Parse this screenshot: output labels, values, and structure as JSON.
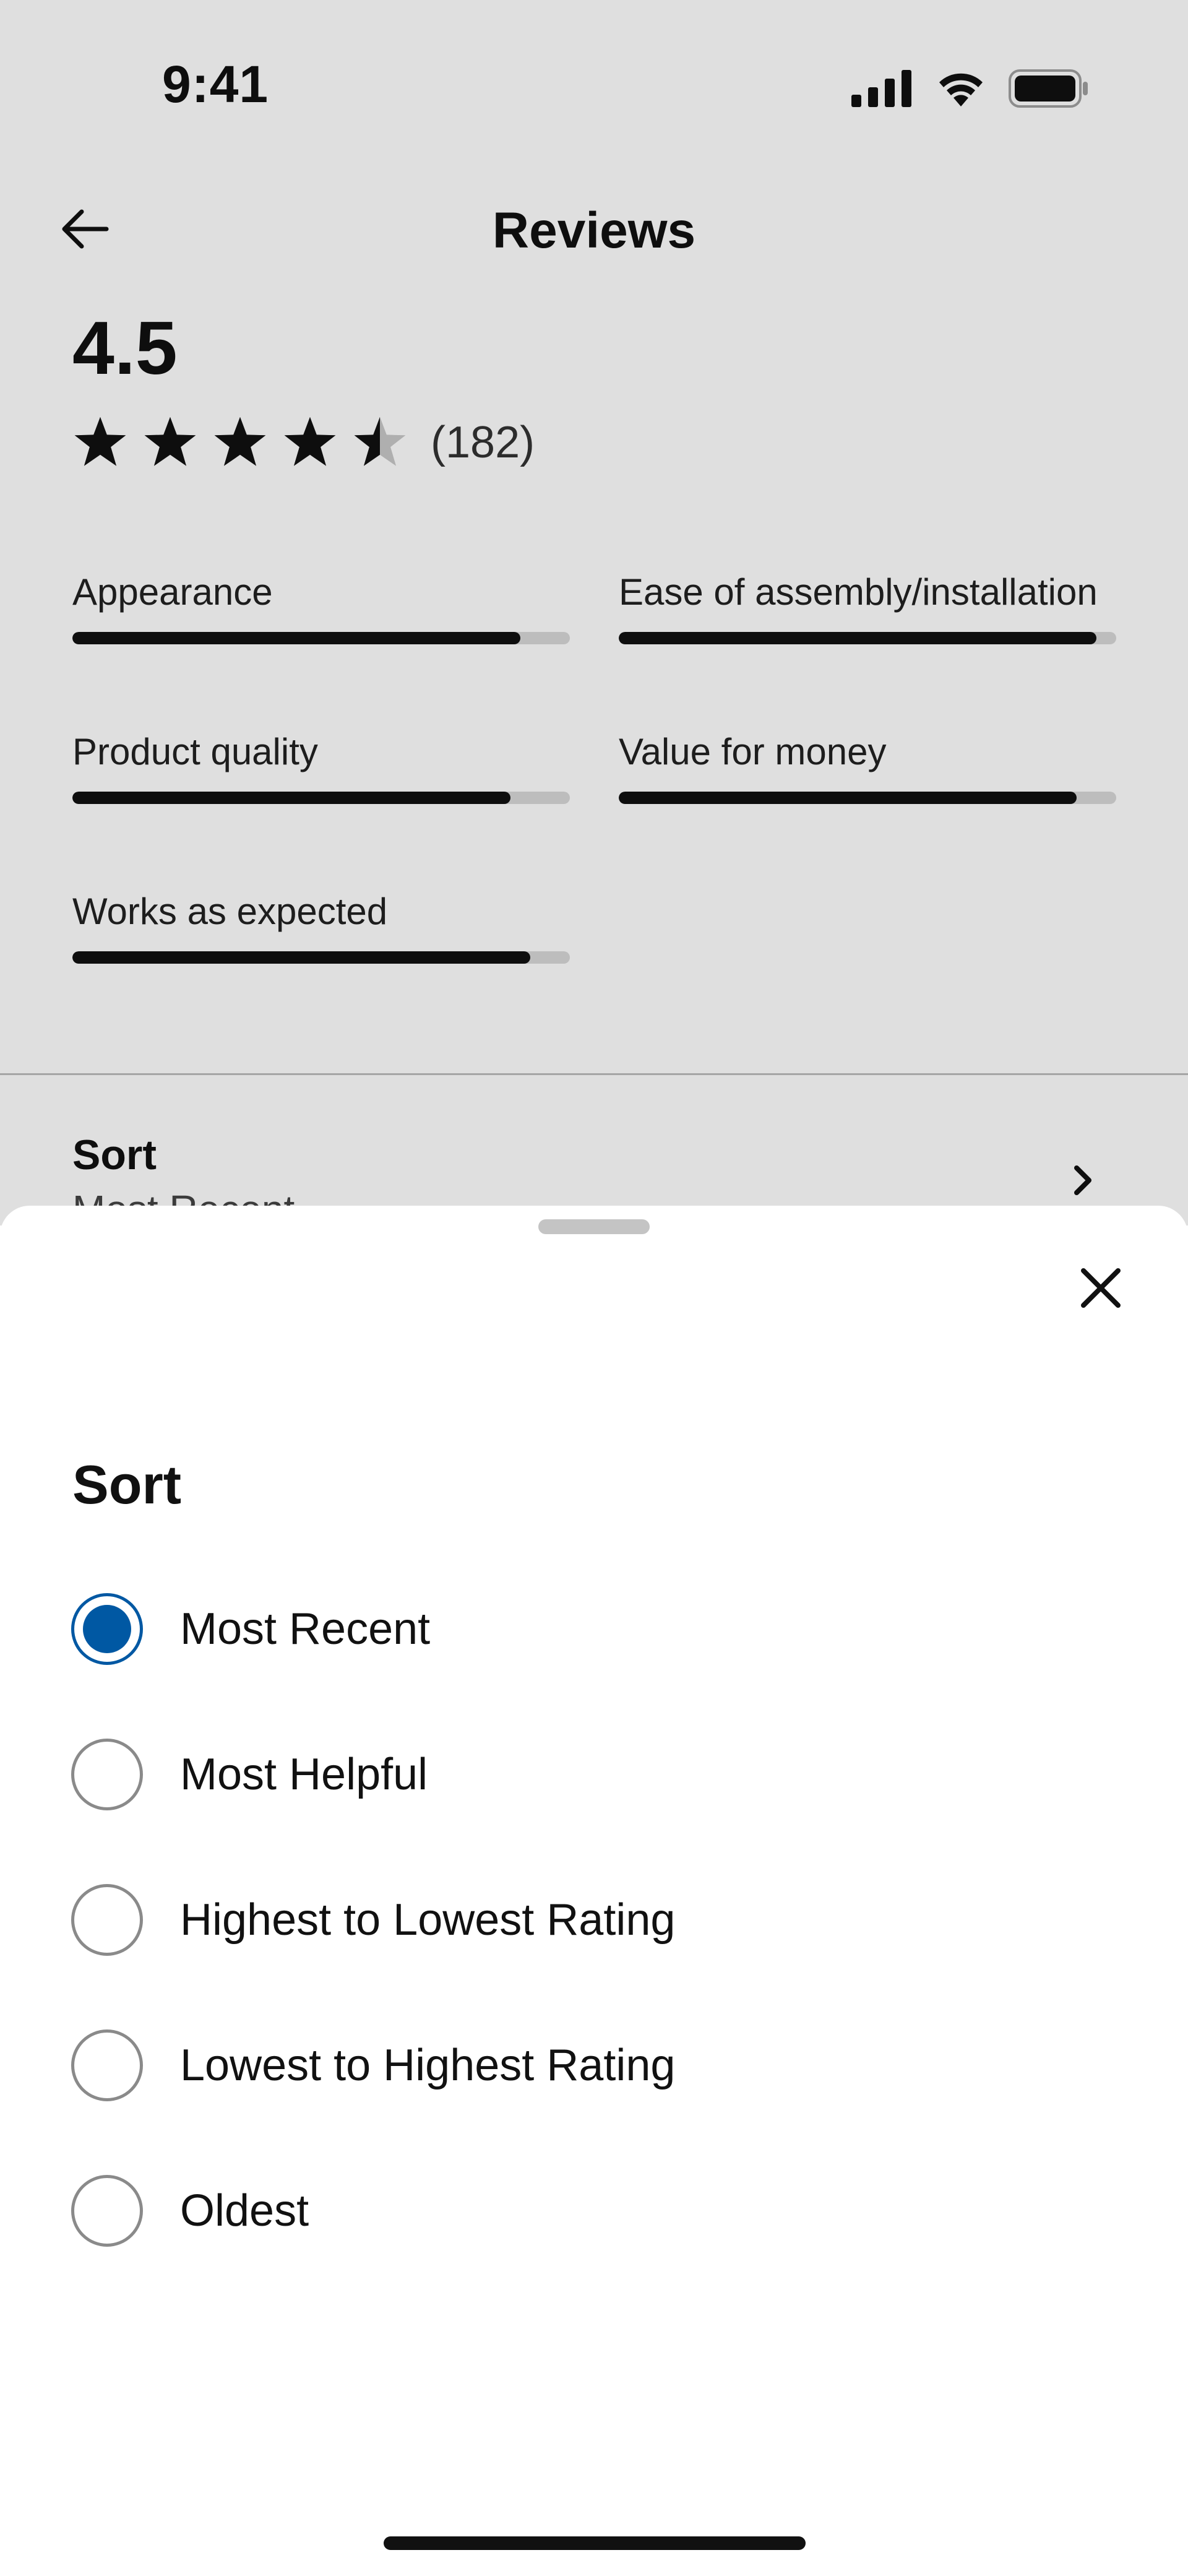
{
  "status_bar": {
    "time": "9:41",
    "icons": [
      "cellular-signal-icon",
      "wifi-icon",
      "battery-icon"
    ]
  },
  "nav": {
    "title": "Reviews",
    "back_icon": "arrow-left-icon"
  },
  "summary": {
    "rating": "4.5",
    "stars_value": 4.5,
    "stars_max": 5,
    "review_count": "(182)"
  },
  "attributes": [
    {
      "label": "Appearance",
      "fill": 0.9
    },
    {
      "label": "Ease of assembly/installation",
      "fill": 0.96
    },
    {
      "label": "Product quality",
      "fill": 0.88
    },
    {
      "label": "Value for money",
      "fill": 0.92
    },
    {
      "label": "Works as expected",
      "fill": 0.92
    }
  ],
  "sort_row": {
    "title": "Sort",
    "value": "Most Recent",
    "chevron_icon": "chevron-right-icon"
  },
  "sheet": {
    "title": "Sort",
    "close_icon": "close-icon",
    "options": [
      {
        "label": "Most Recent",
        "selected": true
      },
      {
        "label": "Most Helpful",
        "selected": false
      },
      {
        "label": "Highest to Lowest Rating",
        "selected": false
      },
      {
        "label": "Lowest to Highest Rating",
        "selected": false
      },
      {
        "label": "Oldest",
        "selected": false
      }
    ]
  },
  "colors": {
    "accent": "#0058a3",
    "text": "#111111",
    "track": "#d8d8d8",
    "scrim": "rgba(0,0,0,0.125)"
  }
}
